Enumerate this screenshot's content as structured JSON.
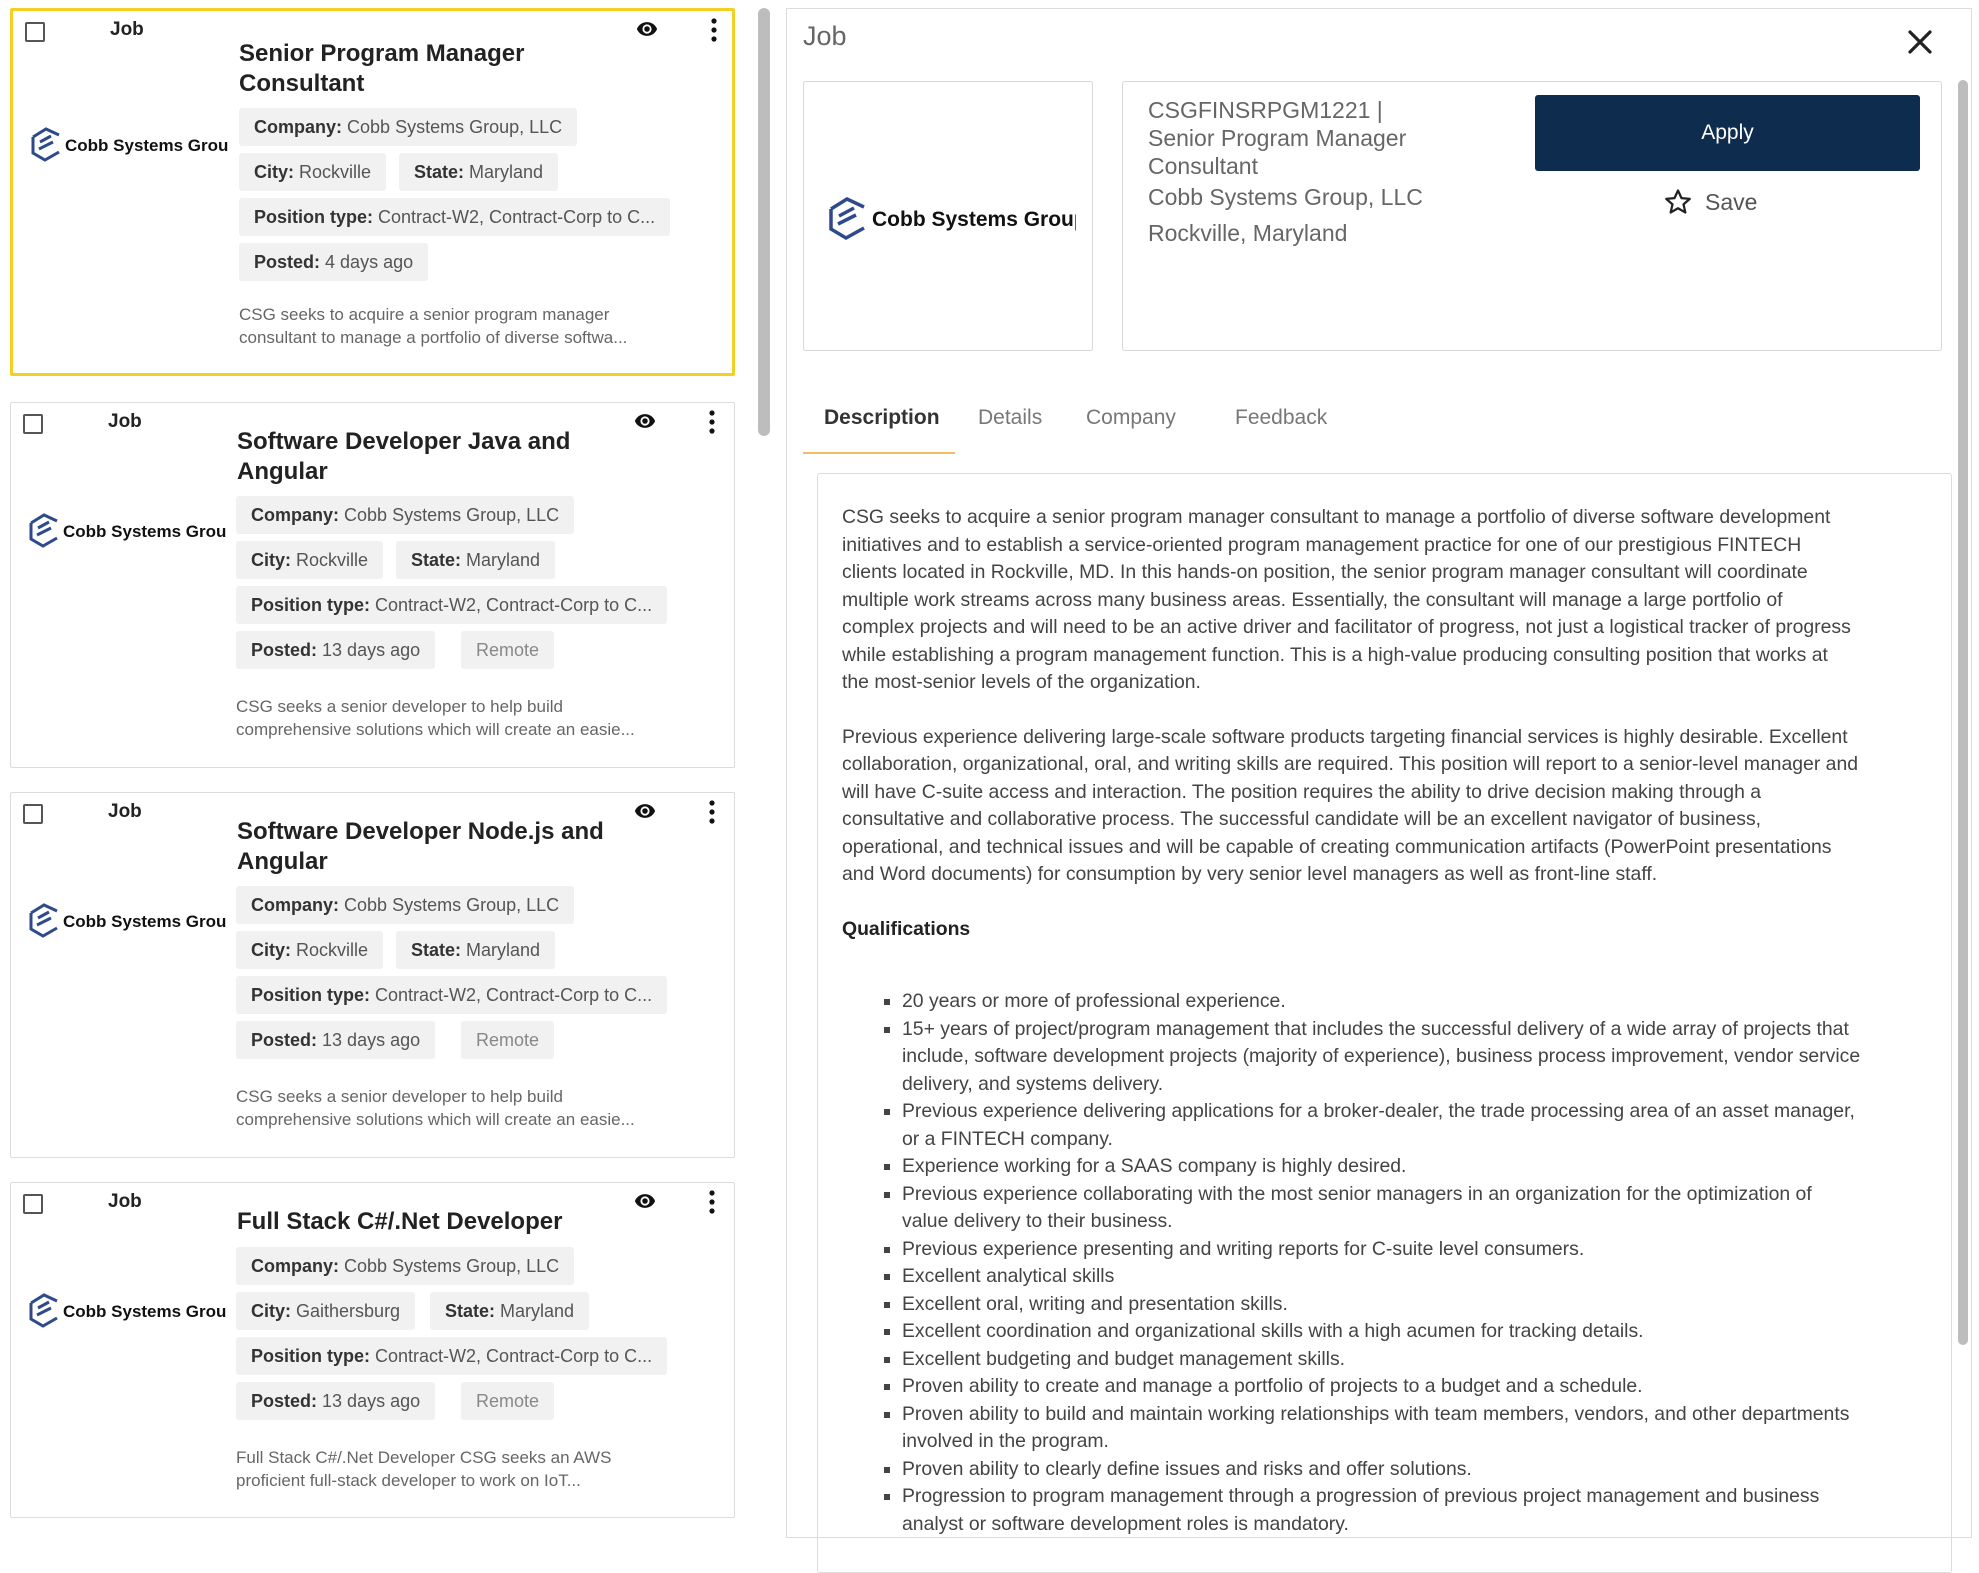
{
  "jobs": [
    {
      "type": "Job",
      "title_lines": [
        "Senior Program Manager",
        "Consultant"
      ],
      "company_label": "Company:",
      "company": "Cobb Systems Group, LLC",
      "city_label": "City:",
      "city": "Rockville",
      "state_label": "State:",
      "state": "Maryland",
      "position_type_label": "Position type:",
      "position_type": "Contract-W2, Contract-Corp to C...",
      "posted_label": "Posted:",
      "posted": "4 days ago",
      "remote": "",
      "snippet_lines": [
        "CSG seeks to acquire a senior program manager",
        "consultant to manage a portfolio of diverse softwa..."
      ]
    },
    {
      "type": "Job",
      "title_lines": [
        "Software Developer Java and",
        "Angular"
      ],
      "company_label": "Company:",
      "company": "Cobb Systems Group, LLC",
      "city_label": "City:",
      "city": "Rockville",
      "state_label": "State:",
      "state": "Maryland",
      "position_type_label": "Position type:",
      "position_type": "Contract-W2, Contract-Corp to C...",
      "posted_label": "Posted:",
      "posted": "13 days ago",
      "remote": "Remote",
      "snippet_lines": [
        "CSG seeks a senior developer to help build",
        "comprehensive solutions which will create an easie..."
      ]
    },
    {
      "type": "Job",
      "title_lines": [
        "Software Developer Node.js and",
        "Angular"
      ],
      "company_label": "Company:",
      "company": "Cobb Systems Group, LLC",
      "city_label": "City:",
      "city": "Rockville",
      "state_label": "State:",
      "state": "Maryland",
      "position_type_label": "Position type:",
      "position_type": "Contract-W2, Contract-Corp to C...",
      "posted_label": "Posted:",
      "posted": "13 days ago",
      "remote": "Remote",
      "snippet_lines": [
        "CSG seeks a senior developer to help build",
        "comprehensive solutions which will create an easie..."
      ]
    },
    {
      "type": "Job",
      "title_lines": [
        "Full Stack C#/.Net Developer"
      ],
      "company_label": "Company:",
      "company": "Cobb Systems Group, LLC",
      "city_label": "City:",
      "city": "Gaithersburg",
      "state_label": "State:",
      "state": "Maryland",
      "position_type_label": "Position type:",
      "position_type": "Contract-W2, Contract-Corp to C...",
      "posted_label": "Posted:",
      "posted": "13 days ago",
      "remote": "Remote",
      "snippet_lines": [
        "Full Stack C#/.Net Developer CSG seeks an AWS",
        "proficient full-stack developer to work on IoT..."
      ]
    }
  ],
  "logo_text": "Cobb Systems Group",
  "detail": {
    "header_title": "Job",
    "code_lines": [
      "CSGFINSRPGM1221 |",
      "Senior Program Manager",
      "Consultant"
    ],
    "company": "Cobb Systems Group, LLC",
    "location": "Rockville, Maryland",
    "apply_label": "Apply",
    "save_label": "Save",
    "tabs": [
      "Description",
      "Details",
      "Company",
      "Feedback"
    ],
    "active_tab": "Description",
    "paragraph1_lines": [
      "CSG seeks to acquire a senior program manager consultant to manage a portfolio of diverse software development",
      "initiatives and to establish a service-oriented program management practice for one of our prestigious FINTECH",
      "clients located in Rockville, MD. In this hands-on position, the senior program manager consultant will coordinate",
      "multiple work streams across many business areas. Essentially, the consultant will manage a large portfolio of",
      "complex projects and will need to be an active driver and facilitator of progress, not just a logistical tracker of progress",
      "while establishing a program management function. This is a high-value producing consulting position that works at",
      "the most-senior levels of the organization."
    ],
    "paragraph2_lines": [
      "Previous experience delivering large-scale software products targeting financial services is highly desirable.  Excellent",
      "collaboration, organizational, oral, and writing skills are required. This position will report to a senior-level manager and",
      "will have C-suite access and interaction. The position requires the ability to drive decision making through a",
      "consultative and collaborative process. The successful candidate will be an excellent navigator of business,",
      "operational, and technical issues and will be capable of creating communication artifacts (PowerPoint presentations",
      "and Word documents) for consumption by very senior level managers as well as front-line staff."
    ],
    "qualifications_heading": "Qualifications",
    "qualifications": [
      [
        "20 years or more of professional experience."
      ],
      [
        "15+ years of project/program management that includes the successful delivery of a wide array of projects that",
        "include, software development projects (majority of experience), business process improvement, vendor service",
        "delivery, and systems delivery."
      ],
      [
        "Previous experience delivering applications for a broker-dealer, the trade processing area of an asset manager,",
        "or a FINTECH company."
      ],
      [
        "Experience working for a SAAS company is highly desired."
      ],
      [
        "Previous experience collaborating with the most senior managers in an organization for the optimization of",
        "value delivery to their business."
      ],
      [
        "Previous experience presenting and writing reports for C-suite level consumers."
      ],
      [
        "Excellent analytical skills"
      ],
      [
        "Excellent oral, writing and presentation skills."
      ],
      [
        "Excellent coordination and organizational skills with a high acumen for tracking details."
      ],
      [
        "Excellent budgeting and budget management skills."
      ],
      [
        "Proven ability to create and manage a portfolio of projects to a budget and a schedule."
      ],
      [
        "Proven ability to build and maintain working relationships with team members, vendors, and other departments",
        "involved in the program."
      ],
      [
        "Proven ability to clearly define issues and risks and offer solutions."
      ],
      [
        "Progression to program management through a progression of previous project management and business",
        "analyst or software development roles is mandatory."
      ]
    ]
  },
  "colors": {
    "selected_border": "#f2d024",
    "apply_bg": "#0e2d4e",
    "tab_underline": "#f0c060"
  },
  "icons": {
    "card_view": "eye-icon",
    "card_menu": "more-vert-icon",
    "close": "close-icon",
    "save": "star-outline-icon"
  }
}
